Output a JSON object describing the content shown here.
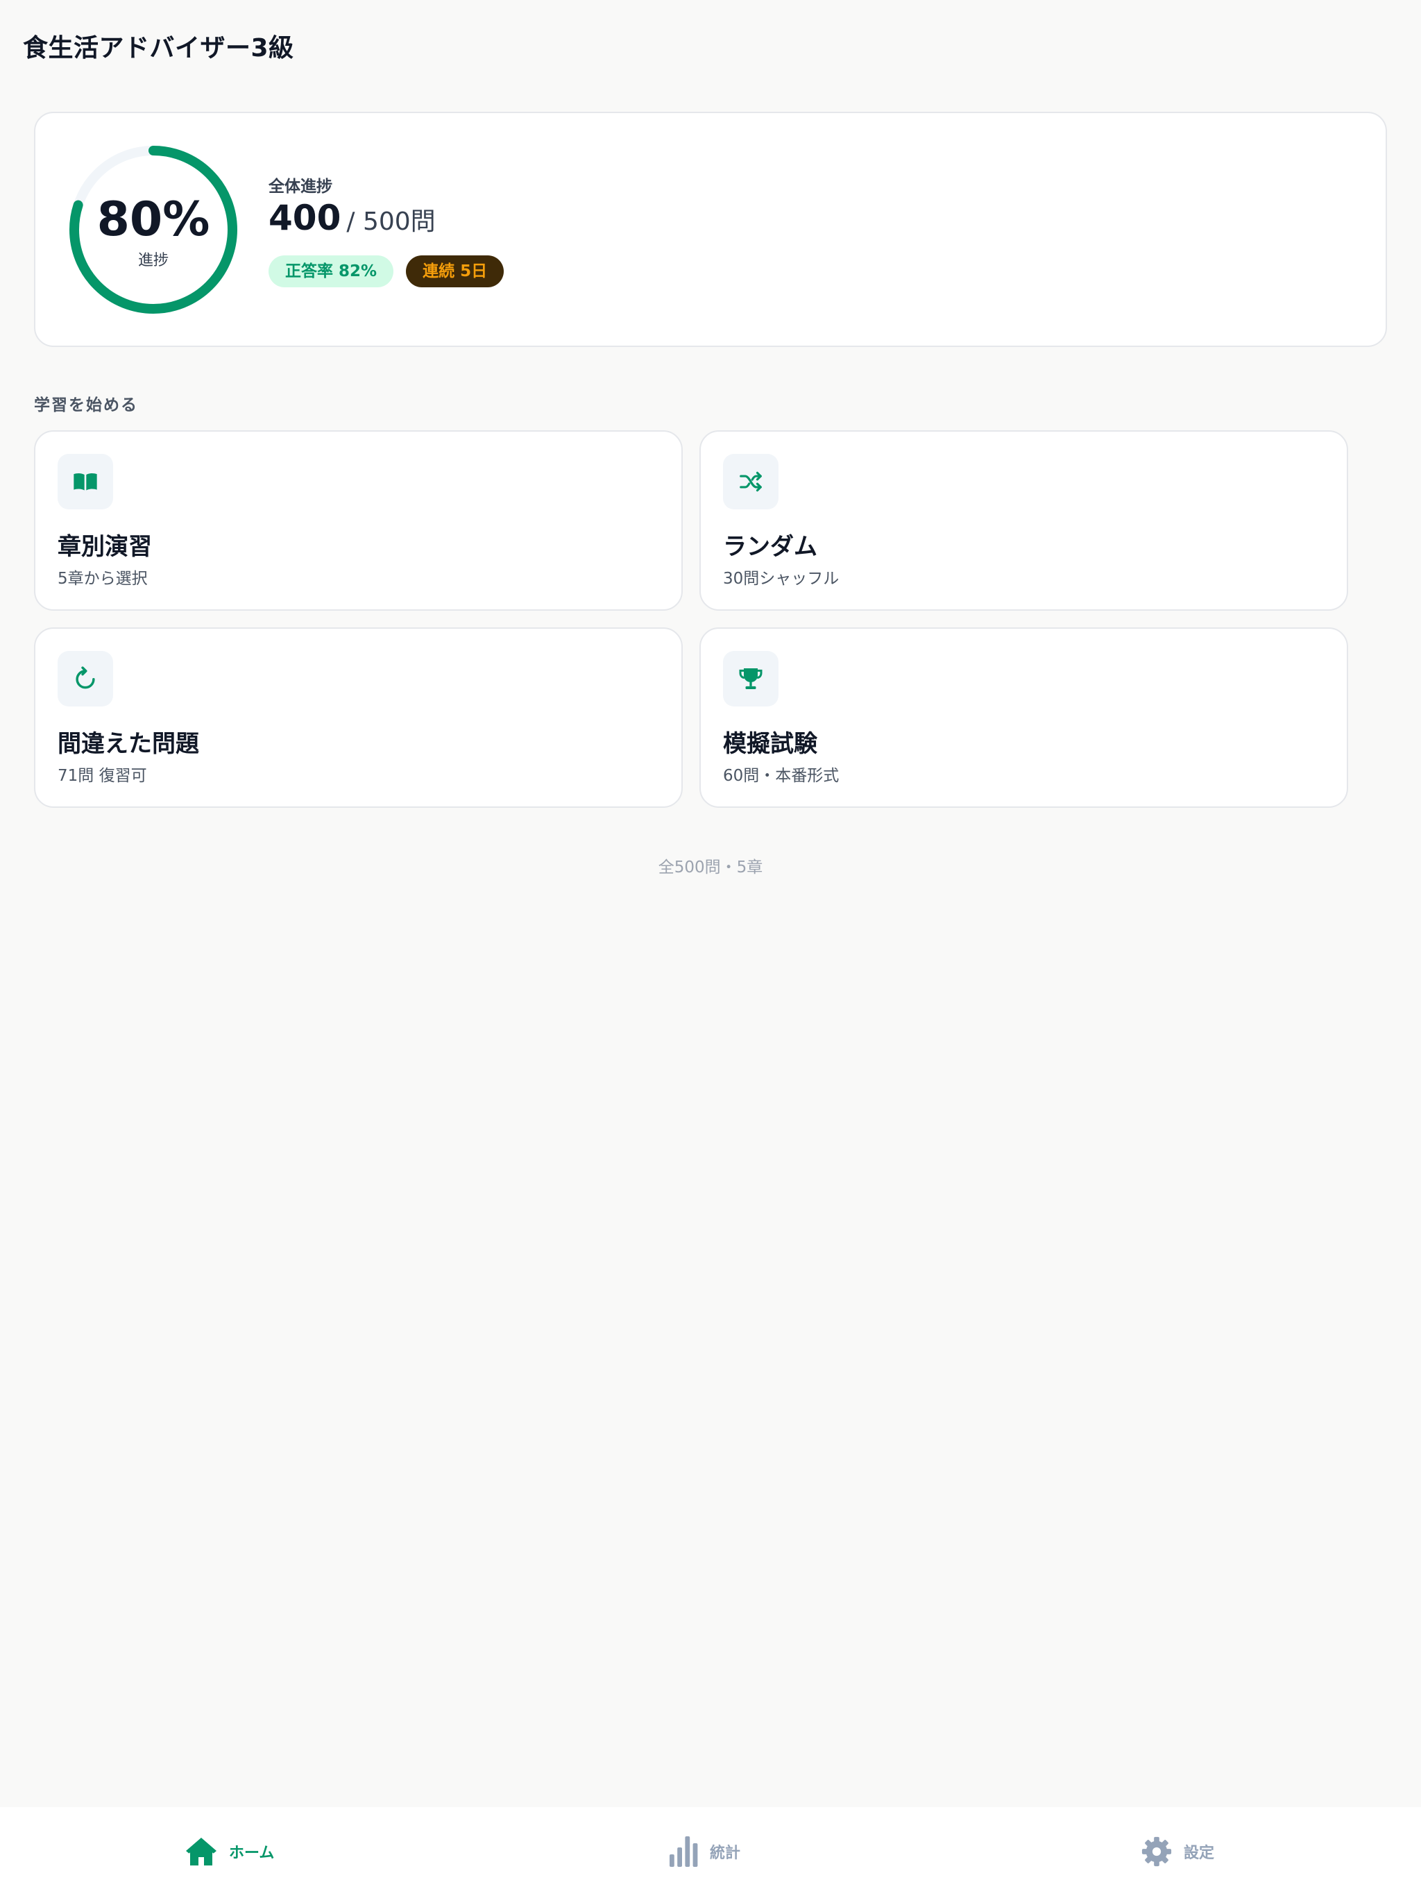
{
  "app": {
    "title": "食生活アドバイザー3級"
  },
  "progress": {
    "percent": 80,
    "percent_label": "80%",
    "caption": "進捗",
    "overall_label": "全体進捗",
    "answered": "400",
    "total_label": "/ 500問",
    "accuracy_badge": "正答率 82%",
    "streak_badge": "連続 5日"
  },
  "section": {
    "title": "学習を始める"
  },
  "cards": [
    {
      "title": "章別演習",
      "subtitle": "5章から選択",
      "icon": "book-icon"
    },
    {
      "title": "ランダム",
      "subtitle": "30問シャッフル",
      "icon": "shuffle-icon"
    },
    {
      "title": "間違えた問題",
      "subtitle": "71問 復習可",
      "icon": "retry-icon"
    },
    {
      "title": "模擬試験",
      "subtitle": "60問・本番形式",
      "icon": "trophy-icon"
    }
  ],
  "footer": {
    "note": "全500問・5章"
  },
  "nav": {
    "items": [
      {
        "label": "ホーム",
        "icon": "home-icon",
        "active": true
      },
      {
        "label": "統計",
        "icon": "bar-chart-icon",
        "active": false
      },
      {
        "label": "設定",
        "icon": "gear-icon",
        "active": false
      }
    ]
  },
  "colors": {
    "accent": "#059669",
    "ring_track": "#f1f5f9",
    "streak_bg": "#3f2a08",
    "streak_text": "#f59e0b",
    "accuracy_bg": "#d1fae5"
  }
}
